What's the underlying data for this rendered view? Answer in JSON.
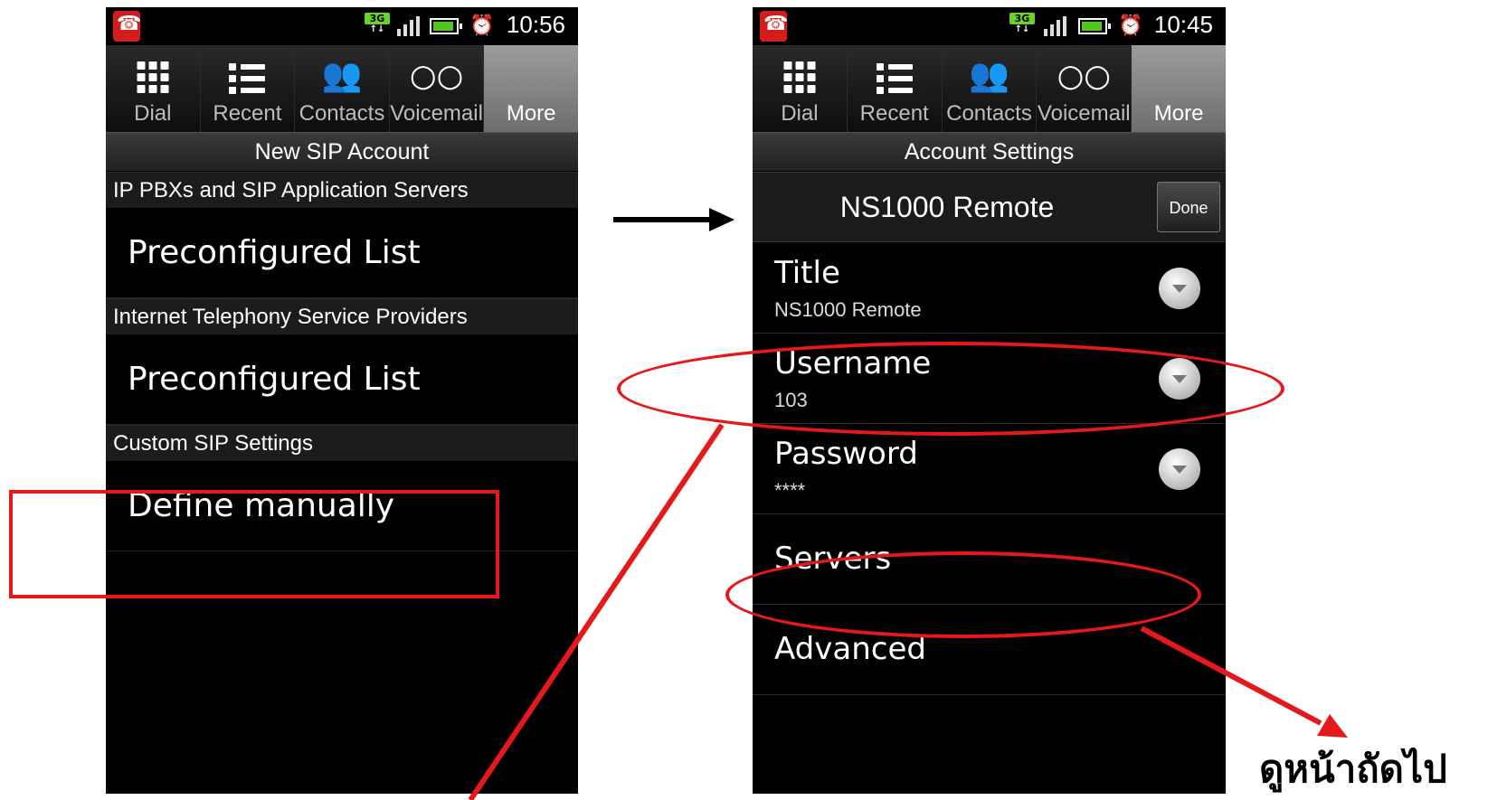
{
  "left_phone": {
    "status": {
      "time": "10:56",
      "network": "3G"
    },
    "tabs": [
      {
        "label": "Dial",
        "icon": "dialpad-icon"
      },
      {
        "label": "Recent",
        "icon": "list-icon"
      },
      {
        "label": "Contacts",
        "icon": "contacts-icon"
      },
      {
        "label": "Voicemail",
        "icon": "voicemail-icon"
      },
      {
        "label": "More",
        "icon": "more-icon",
        "active": true
      }
    ],
    "title": "New SIP Account",
    "sections": [
      {
        "header": "IP PBXs and SIP Application Servers",
        "item": "Preconfigured List"
      },
      {
        "header": "Internet Telephony Service Providers",
        "item": "Preconfigured List"
      },
      {
        "header": "Custom SIP Settings",
        "item": "Define manually"
      }
    ]
  },
  "right_phone": {
    "status": {
      "time": "10:45",
      "network": "3G"
    },
    "tabs": [
      {
        "label": "Dial",
        "icon": "dialpad-icon"
      },
      {
        "label": "Recent",
        "icon": "list-icon"
      },
      {
        "label": "Contacts",
        "icon": "contacts-icon"
      },
      {
        "label": "Voicemail",
        "icon": "voicemail-icon"
      },
      {
        "label": "More",
        "icon": "more-icon",
        "active": true
      }
    ],
    "title": "Account Settings",
    "account_name": "NS1000 Remote",
    "done_label": "Done",
    "settings": [
      {
        "label": "Title",
        "value": "NS1000 Remote",
        "dropdown": true
      },
      {
        "label": "Username",
        "value": "103",
        "dropdown": true
      },
      {
        "label": "Password",
        "value": "****",
        "dropdown": true
      },
      {
        "label": "Servers",
        "value": "",
        "dropdown": false
      },
      {
        "label": "Advanced",
        "value": "",
        "dropdown": false
      }
    ]
  },
  "caption": "ดูหน้าถัดไป",
  "colors": {
    "highlight": "#e5191b",
    "accent_green": "#6bd12b",
    "phone_bg": "#000000"
  }
}
